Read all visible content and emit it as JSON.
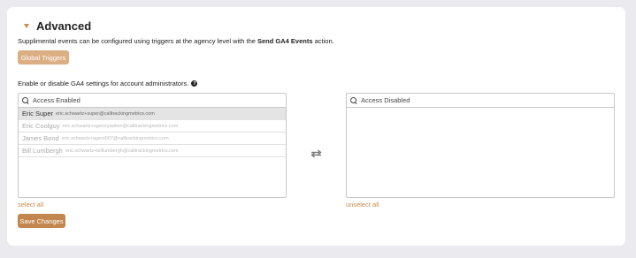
{
  "section": {
    "title": "Advanced",
    "description_prefix": "Supplimental events can be configured using triggers at the agency level with the ",
    "description_bold": "Send GA4 Events",
    "description_suffix": " action."
  },
  "buttons": {
    "global_triggers": "Global Triggers",
    "save_changes": "Save Changes"
  },
  "permissions": {
    "label": "Enable or disable GA4 settings for account administrators.",
    "help_icon": "question-circle-icon",
    "swap_icon": "transfer-arrows-icon"
  },
  "enabled_list": {
    "placeholder": "Access Enabled",
    "items": [
      {
        "name": "Eric Super",
        "email": "eric.schwartz+super@calltrackingmetrics.com",
        "selected": true
      },
      {
        "name": "Eric Coolguy",
        "email": "eric.schwartz+agencyadmin@calltrackingmetrics.com",
        "selected": false
      },
      {
        "name": "James Bond",
        "email": "eric.schwartz+agent007@calltrackingmetrics.com",
        "selected": false
      },
      {
        "name": "Bill Lumbergh",
        "email": "eric.schwartz+billlumbergh@calltrackingmetrics.com",
        "selected": false
      }
    ],
    "select_all": "select all"
  },
  "disabled_list": {
    "placeholder": "Access Disabled",
    "items": [],
    "unselect_all": "unselect all"
  },
  "colors": {
    "accent": "#c98a4e",
    "triggers_button": "#dcae84",
    "save_button": "#c2874f",
    "background": "#ebebef"
  }
}
